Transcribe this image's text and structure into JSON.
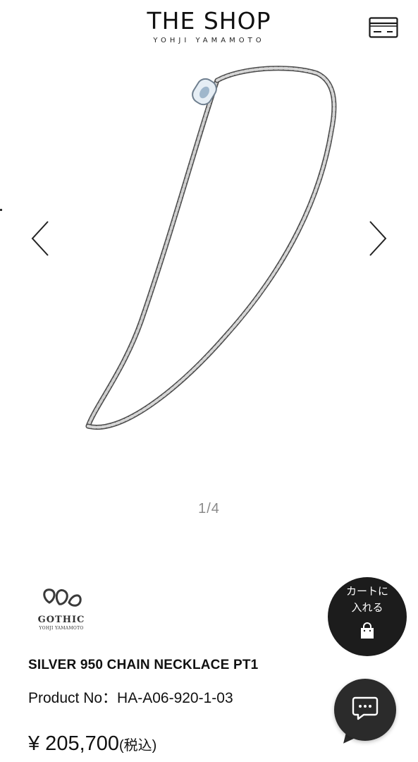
{
  "header": {
    "title": "THE SHOP",
    "subtitle": "YOHJI YAMAMOTO",
    "menu_icon": "card-icon"
  },
  "gallery": {
    "image": "silver-chain-necklace",
    "prev_icon": "chevron-left-icon",
    "next_icon": "chevron-right-icon",
    "pager": "1/4",
    "current_page": 1,
    "total_pages": 4
  },
  "brand": {
    "logo_text": "GOTHIC",
    "logo_subtext": "YOHJI YAMAMOTO"
  },
  "cart_button": {
    "line1": "カートに",
    "line2": "入れる",
    "icon": "shopping-bag-icon"
  },
  "product": {
    "name": "SILVER 950 CHAIN NECKLACE PT1",
    "product_no": "Product No：HA-A06-920-1-03",
    "price": "¥ 205,700",
    "tax_label": "(税込)"
  },
  "chat": {
    "icon": "chat-icon"
  },
  "colors": {
    "text": "#111111",
    "pager": "#8a8a8a",
    "button_bg": "#1c1c1c",
    "chat_bg": "#2b2b2b",
    "chain_silver": "#a9a9a9"
  }
}
